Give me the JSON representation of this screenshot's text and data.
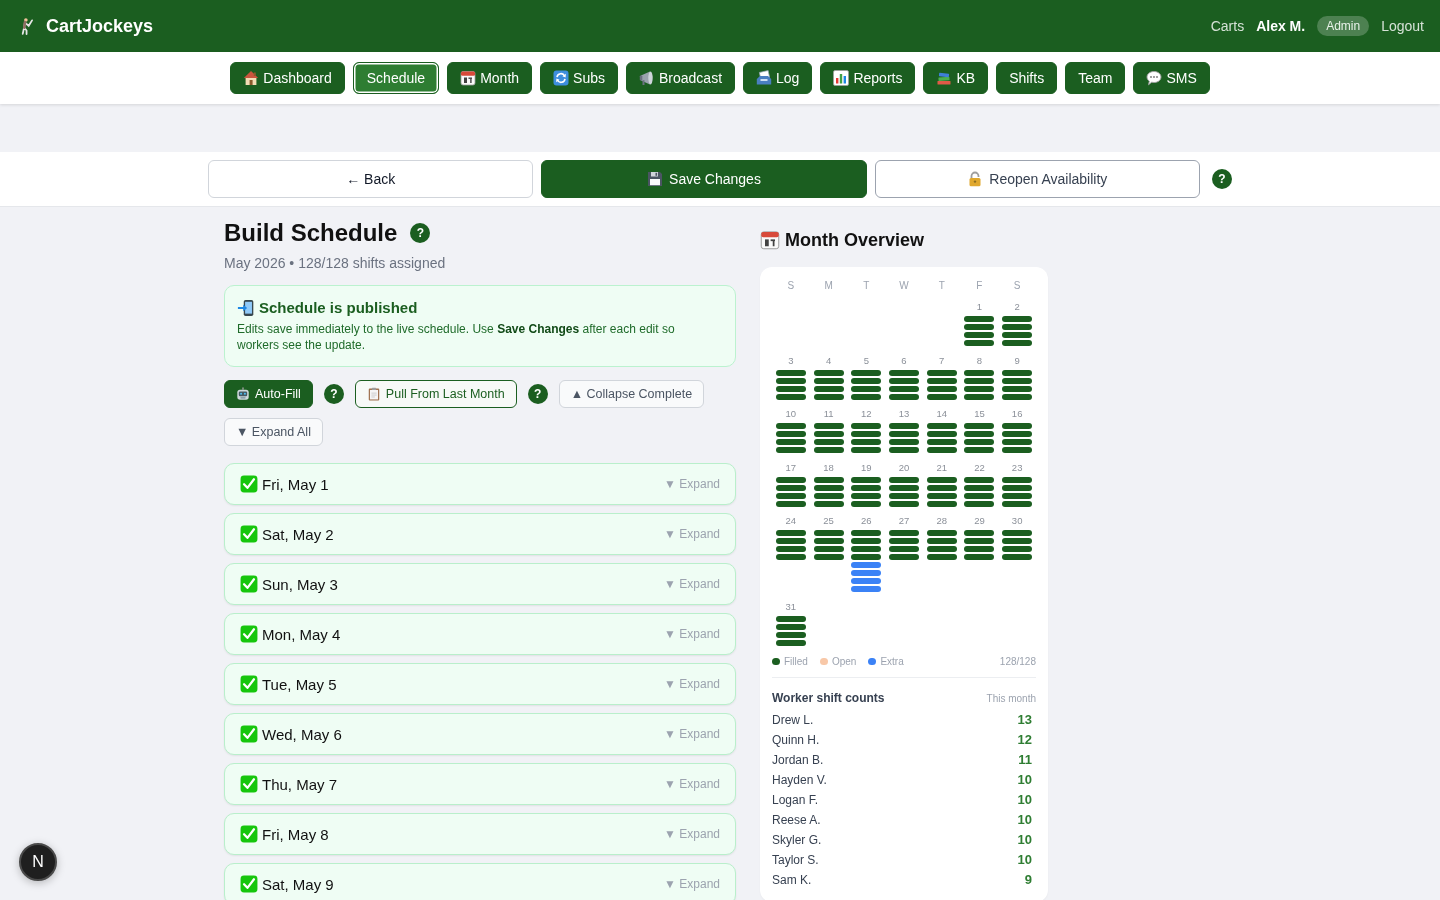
{
  "header": {
    "brand": "CartJockeys",
    "links": [
      {
        "label": "Carts"
      }
    ],
    "user_name": "Alex M.",
    "role": "Admin",
    "logout": "Logout"
  },
  "nav": [
    {
      "label": "Dashboard",
      "selected": false
    },
    {
      "label": "Schedule",
      "selected": true
    },
    {
      "label": "Month",
      "selected": false
    },
    {
      "label": "Subs",
      "selected": false
    },
    {
      "label": "Broadcast",
      "selected": false
    },
    {
      "label": "Log",
      "selected": false
    },
    {
      "label": "Reports",
      "selected": false
    },
    {
      "label": "KB",
      "selected": false
    },
    {
      "label": "Shifts",
      "selected": false
    },
    {
      "label": "Team",
      "selected": false
    },
    {
      "label": "SMS",
      "selected": false
    }
  ],
  "action_bar": {
    "buttons": [
      {
        "kind": "outline",
        "label": "← Back"
      },
      {
        "kind": "primary",
        "label": "Save Changes"
      },
      {
        "kind": "secondary",
        "label": "Reopen Availability"
      }
    ],
    "help": "?"
  },
  "builder": {
    "title": "Build Schedule",
    "title_help": "?",
    "subtitle": "May 2026 • 128/128 shifts assigned",
    "notice": {
      "title": "Schedule is published",
      "body": "Edits save immediately to the live schedule. Use **Save Changes** after each edit so workers see the update."
    },
    "tools": [
      {
        "kind": "primary",
        "label": "Auto-Fill"
      },
      {
        "kind": "help",
        "label": "?"
      },
      {
        "kind": "outline",
        "label": "Pull From Last Month"
      },
      {
        "kind": "help",
        "label": "?"
      },
      {
        "kind": "plain",
        "label": "▲ Collapse Complete"
      },
      {
        "kind": "plain",
        "label": "▼ Expand All"
      }
    ],
    "days": [
      {
        "label": "Fri, May 1",
        "complete": true,
        "toggle": "▼ Expand"
      },
      {
        "label": "Sat, May 2",
        "complete": true,
        "toggle": "▼ Expand"
      },
      {
        "label": "Sun, May 3",
        "complete": true,
        "toggle": "▼ Expand"
      },
      {
        "label": "Mon, May 4",
        "complete": true,
        "toggle": "▼ Expand"
      },
      {
        "label": "Tue, May 5",
        "complete": true,
        "toggle": "▼ Expand"
      },
      {
        "label": "Wed, May 6",
        "complete": true,
        "toggle": "▼ Expand"
      },
      {
        "label": "Thu, May 7",
        "complete": true,
        "toggle": "▼ Expand"
      },
      {
        "label": "Fri, May 8",
        "complete": true,
        "toggle": "▼ Expand"
      },
      {
        "label": "Sat, May 9",
        "complete": true,
        "toggle": "▼ Expand"
      }
    ]
  },
  "overview": {
    "title": "Month Overview",
    "weekdays": [
      "S",
      "M",
      "T",
      "W",
      "T",
      "F",
      "S"
    ],
    "weeks": [
      [
        {
          "day": "1",
          "shifts": [
            {
              "kind": "filled"
            },
            {
              "kind": "filled"
            },
            {
              "kind": "filled"
            },
            {
              "kind": "filled"
            }
          ]
        },
        {
          "day": "2",
          "shifts": [
            {
              "kind": "filled"
            },
            {
              "kind": "filled"
            },
            {
              "kind": "filled"
            },
            {
              "kind": "filled"
            }
          ]
        }
      ],
      [
        {
          "day": "3",
          "shifts": [
            {
              "kind": "filled"
            },
            {
              "kind": "filled"
            },
            {
              "kind": "filled"
            },
            {
              "kind": "filled"
            }
          ]
        },
        {
          "day": "4",
          "shifts": [
            {
              "kind": "filled"
            },
            {
              "kind": "filled"
            },
            {
              "kind": "filled"
            },
            {
              "kind": "filled"
            }
          ]
        },
        {
          "day": "5",
          "shifts": [
            {
              "kind": "filled"
            },
            {
              "kind": "filled"
            },
            {
              "kind": "filled"
            },
            {
              "kind": "filled"
            }
          ]
        },
        {
          "day": "6",
          "shifts": [
            {
              "kind": "filled"
            },
            {
              "kind": "filled"
            },
            {
              "kind": "filled"
            },
            {
              "kind": "filled"
            }
          ]
        },
        {
          "day": "7",
          "shifts": [
            {
              "kind": "filled"
            },
            {
              "kind": "filled"
            },
            {
              "kind": "filled"
            },
            {
              "kind": "filled"
            }
          ]
        },
        {
          "day": "8",
          "shifts": [
            {
              "kind": "filled"
            },
            {
              "kind": "filled"
            },
            {
              "kind": "filled"
            },
            {
              "kind": "filled"
            }
          ]
        },
        {
          "day": "9",
          "shifts": [
            {
              "kind": "filled"
            },
            {
              "kind": "filled"
            },
            {
              "kind": "filled"
            },
            {
              "kind": "filled"
            }
          ]
        }
      ],
      [
        {
          "day": "10",
          "shifts": [
            {
              "kind": "filled"
            },
            {
              "kind": "filled"
            },
            {
              "kind": "filled"
            },
            {
              "kind": "filled"
            }
          ]
        },
        {
          "day": "11",
          "shifts": [
            {
              "kind": "filled"
            },
            {
              "kind": "filled"
            },
            {
              "kind": "filled"
            },
            {
              "kind": "filled"
            }
          ]
        },
        {
          "day": "12",
          "shifts": [
            {
              "kind": "filled"
            },
            {
              "kind": "filled"
            },
            {
              "kind": "filled"
            },
            {
              "kind": "filled"
            }
          ]
        },
        {
          "day": "13",
          "shifts": [
            {
              "kind": "filled"
            },
            {
              "kind": "filled"
            },
            {
              "kind": "filled"
            },
            {
              "kind": "filled"
            }
          ]
        },
        {
          "day": "14",
          "shifts": [
            {
              "kind": "filled"
            },
            {
              "kind": "filled"
            },
            {
              "kind": "filled"
            },
            {
              "kind": "filled"
            }
          ]
        },
        {
          "day": "15",
          "shifts": [
            {
              "kind": "filled"
            },
            {
              "kind": "filled"
            },
            {
              "kind": "filled"
            },
            {
              "kind": "filled"
            }
          ]
        },
        {
          "day": "16",
          "shifts": [
            {
              "kind": "filled"
            },
            {
              "kind": "filled"
            },
            {
              "kind": "filled"
            },
            {
              "kind": "filled"
            }
          ]
        }
      ],
      [
        {
          "day": "17",
          "shifts": [
            {
              "kind": "filled"
            },
            {
              "kind": "filled"
            },
            {
              "kind": "filled"
            },
            {
              "kind": "filled"
            }
          ]
        },
        {
          "day": "18",
          "shifts": [
            {
              "kind": "filled"
            },
            {
              "kind": "filled"
            },
            {
              "kind": "filled"
            },
            {
              "kind": "filled"
            }
          ]
        },
        {
          "day": "19",
          "shifts": [
            {
              "kind": "filled"
            },
            {
              "kind": "filled"
            },
            {
              "kind": "filled"
            },
            {
              "kind": "filled"
            }
          ]
        },
        {
          "day": "20",
          "shifts": [
            {
              "kind": "filled"
            },
            {
              "kind": "filled"
            },
            {
              "kind": "filled"
            },
            {
              "kind": "filled"
            }
          ]
        },
        {
          "day": "21",
          "shifts": [
            {
              "kind": "filled"
            },
            {
              "kind": "filled"
            },
            {
              "kind": "filled"
            },
            {
              "kind": "filled"
            }
          ]
        },
        {
          "day": "22",
          "shifts": [
            {
              "kind": "filled"
            },
            {
              "kind": "filled"
            },
            {
              "kind": "filled"
            },
            {
              "kind": "filled"
            }
          ]
        },
        {
          "day": "23",
          "shifts": [
            {
              "kind": "filled"
            },
            {
              "kind": "filled"
            },
            {
              "kind": "filled"
            },
            {
              "kind": "filled"
            }
          ]
        }
      ],
      [
        {
          "day": "24",
          "shifts": [
            {
              "kind": "filled"
            },
            {
              "kind": "filled"
            },
            {
              "kind": "filled"
            },
            {
              "kind": "filled"
            }
          ]
        },
        {
          "day": "25",
          "shifts": [
            {
              "kind": "filled"
            },
            {
              "kind": "filled"
            },
            {
              "kind": "filled"
            },
            {
              "kind": "filled"
            }
          ]
        },
        {
          "day": "26",
          "shifts": [
            {
              "kind": "filled"
            },
            {
              "kind": "filled"
            },
            {
              "kind": "filled"
            },
            {
              "kind": "filled"
            },
            {
              "kind": "extra"
            },
            {
              "kind": "extra"
            },
            {
              "kind": "extra"
            },
            {
              "kind": "extra"
            }
          ]
        },
        {
          "day": "27",
          "shifts": [
            {
              "kind": "filled"
            },
            {
              "kind": "filled"
            },
            {
              "kind": "filled"
            },
            {
              "kind": "filled"
            }
          ]
        },
        {
          "day": "28",
          "shifts": [
            {
              "kind": "filled"
            },
            {
              "kind": "filled"
            },
            {
              "kind": "filled"
            },
            {
              "kind": "filled"
            }
          ]
        },
        {
          "day": "29",
          "shifts": [
            {
              "kind": "filled"
            },
            {
              "kind": "filled"
            },
            {
              "kind": "filled"
            },
            {
              "kind": "filled"
            }
          ]
        },
        {
          "day": "30",
          "shifts": [
            {
              "kind": "filled"
            },
            {
              "kind": "filled"
            },
            {
              "kind": "filled"
            },
            {
              "kind": "filled"
            }
          ]
        }
      ],
      [
        {
          "day": "31",
          "shifts": [
            {
              "kind": "filled"
            },
            {
              "kind": "filled"
            },
            {
              "kind": "filled"
            },
            {
              "kind": "filled"
            }
          ]
        }
      ]
    ],
    "legend": [
      {
        "kind": "filled",
        "label": "Filled",
        "color": "#1b5e20"
      },
      {
        "kind": "open",
        "label": "Open",
        "color": "#f8c8a8"
      },
      {
        "kind": "extra",
        "label": "Extra",
        "color": "#3b82f6"
      }
    ],
    "total": "128/128",
    "workers_title": "Worker shift counts",
    "workers_period": "This month",
    "workers": [
      {
        "name": "Drew L.",
        "count": "13"
      },
      {
        "name": "Quinn H.",
        "count": "12"
      },
      {
        "name": "Jordan B.",
        "count": "11"
      },
      {
        "name": "Hayden V.",
        "count": "10"
      },
      {
        "name": "Logan F.",
        "count": "10"
      },
      {
        "name": "Reese A.",
        "count": "10"
      },
      {
        "name": "Skyler G.",
        "count": "10"
      },
      {
        "name": "Taylor S.",
        "count": "10"
      },
      {
        "name": "Sam K.",
        "count": "9"
      }
    ]
  },
  "dev_badge": "N"
}
